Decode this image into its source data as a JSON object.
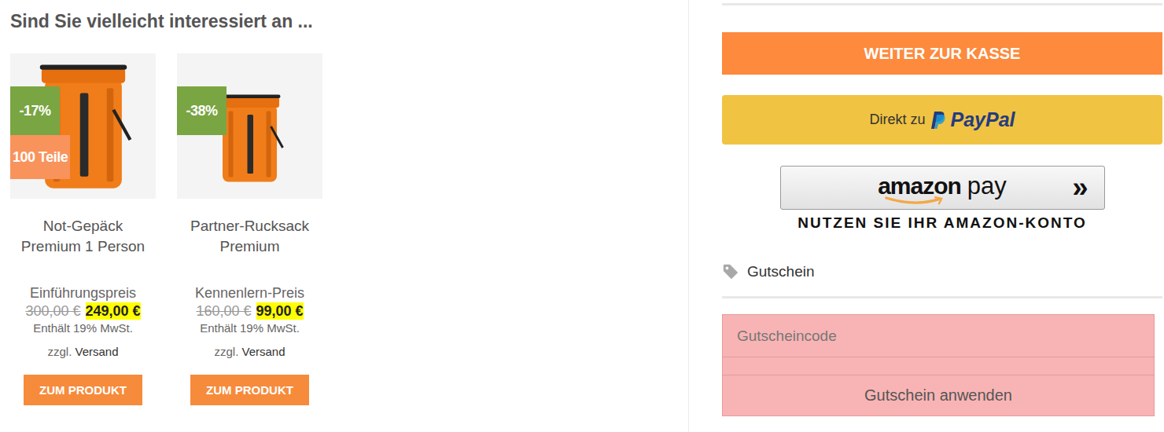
{
  "heading": "Sind Sie vielleicht interessiert an ...",
  "products": [
    {
      "name": "Not-Gepäck Premium 1 Person",
      "badges": [
        {
          "text": "-17%",
          "color": "#7aa543"
        },
        {
          "text": "100 Teile",
          "color": "#f9935c"
        }
      ],
      "price_label": "Einführungspreis",
      "old_price": "300,00 €",
      "price": "249,00 €",
      "tax_note": "Enthält 19% MwSt.",
      "shipping_prefix": "zzgl.",
      "shipping_link": "Versand",
      "button": "ZUM PRODUKT"
    },
    {
      "name": "Partner-Rucksack Premium",
      "badges": [
        {
          "text": "-38%",
          "color": "#7aa543"
        }
      ],
      "price_label": "Kennenlern-Preis",
      "old_price": "160,00 €",
      "price": "99,00 €",
      "tax_note": "Enthält 19% MwSt.",
      "shipping_prefix": "zzgl.",
      "shipping_link": "Versand",
      "button": "ZUM PRODUKT"
    }
  ],
  "checkout": {
    "button": "WEITER ZUR KASSE"
  },
  "paypal": {
    "prefix": "Direkt zu",
    "logo": "PayPal"
  },
  "amazon_pay": {
    "brand": "amazon",
    "suffix": "pay",
    "arrows": "»",
    "caption": "NUTZEN SIE IHR AMAZON-KONTO"
  },
  "coupon": {
    "title": "Gutschein",
    "placeholder": "Gutscheincode",
    "button": "Gutschein anwenden",
    "highlighted": true
  }
}
